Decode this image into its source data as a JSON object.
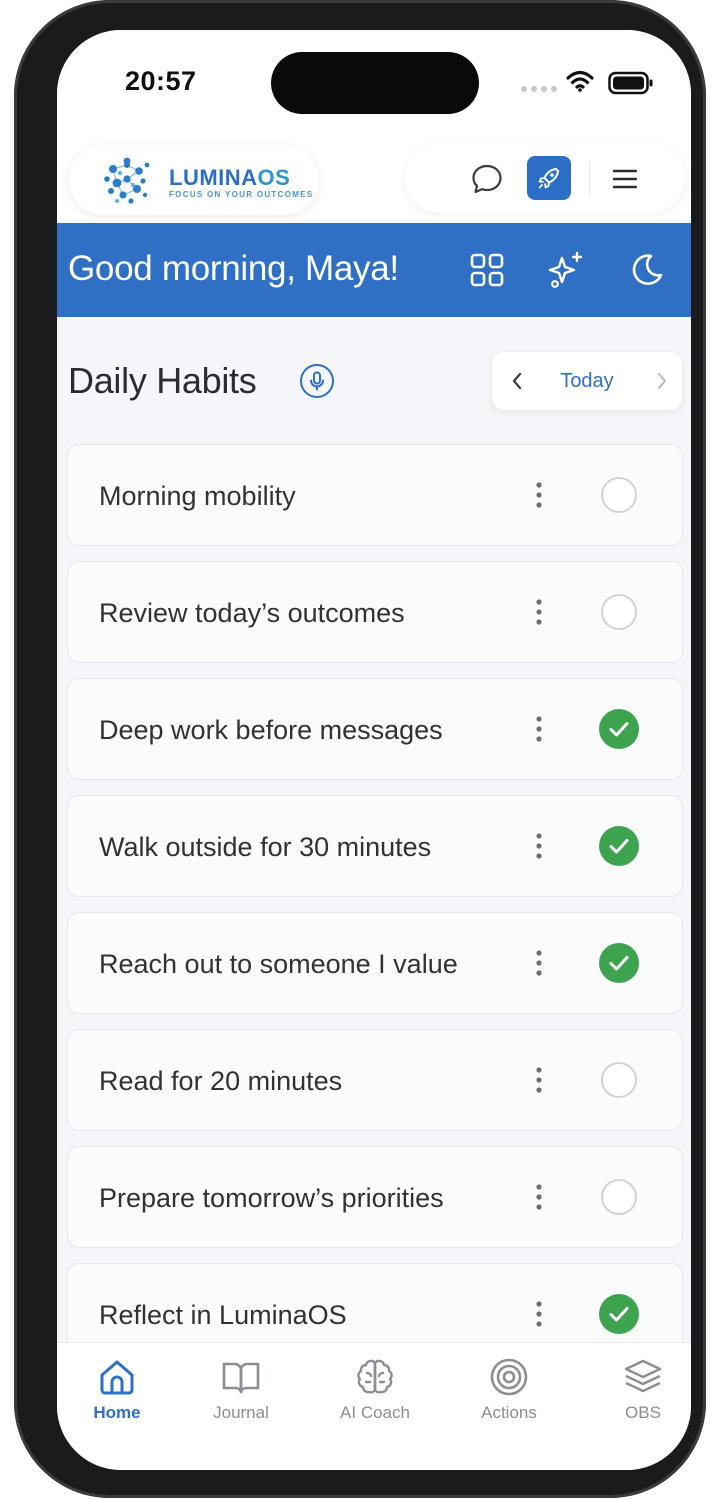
{
  "status_bar": {
    "time": "20:57"
  },
  "header": {
    "logo_name_main": "LUMINA",
    "logo_name_suffix": "OS",
    "logo_tagline": "FOCUS ON YOUR OUTCOMES",
    "icons": [
      "chat-bubble-icon",
      "rocket-icon",
      "hamburger-menu-icon"
    ],
    "accent_color": "#2f6fc4"
  },
  "greeting": {
    "text": "Good morning, Maya!",
    "icons": [
      "grid-icon",
      "sparkle-icon",
      "moon-icon"
    ],
    "background_color": "#2f6fc4"
  },
  "section": {
    "title": "Daily Habits",
    "date_label": "Today"
  },
  "habits": [
    {
      "name": "Morning mobility",
      "done": false
    },
    {
      "name": "Review today’s outcomes",
      "done": false
    },
    {
      "name": "Deep work before messages",
      "done": true
    },
    {
      "name": "Walk outside for 30 minutes",
      "done": true
    },
    {
      "name": "Reach out to someone I value",
      "done": true
    },
    {
      "name": "Read for 20 minutes",
      "done": false
    },
    {
      "name": "Prepare tomorrow’s priorities",
      "done": false
    },
    {
      "name": "Reflect in LuminaOS",
      "done": true
    }
  ],
  "done_color": "#3ea34f",
  "bottom_nav": [
    {
      "label": "Home",
      "icon": "home-icon",
      "active": true
    },
    {
      "label": "Journal",
      "icon": "book-icon",
      "active": false
    },
    {
      "label": "AI Coach",
      "icon": "brain-icon",
      "active": false
    },
    {
      "label": "Actions",
      "icon": "target-icon",
      "active": false
    },
    {
      "label": "OBS",
      "icon": "layers-icon",
      "active": false
    }
  ]
}
